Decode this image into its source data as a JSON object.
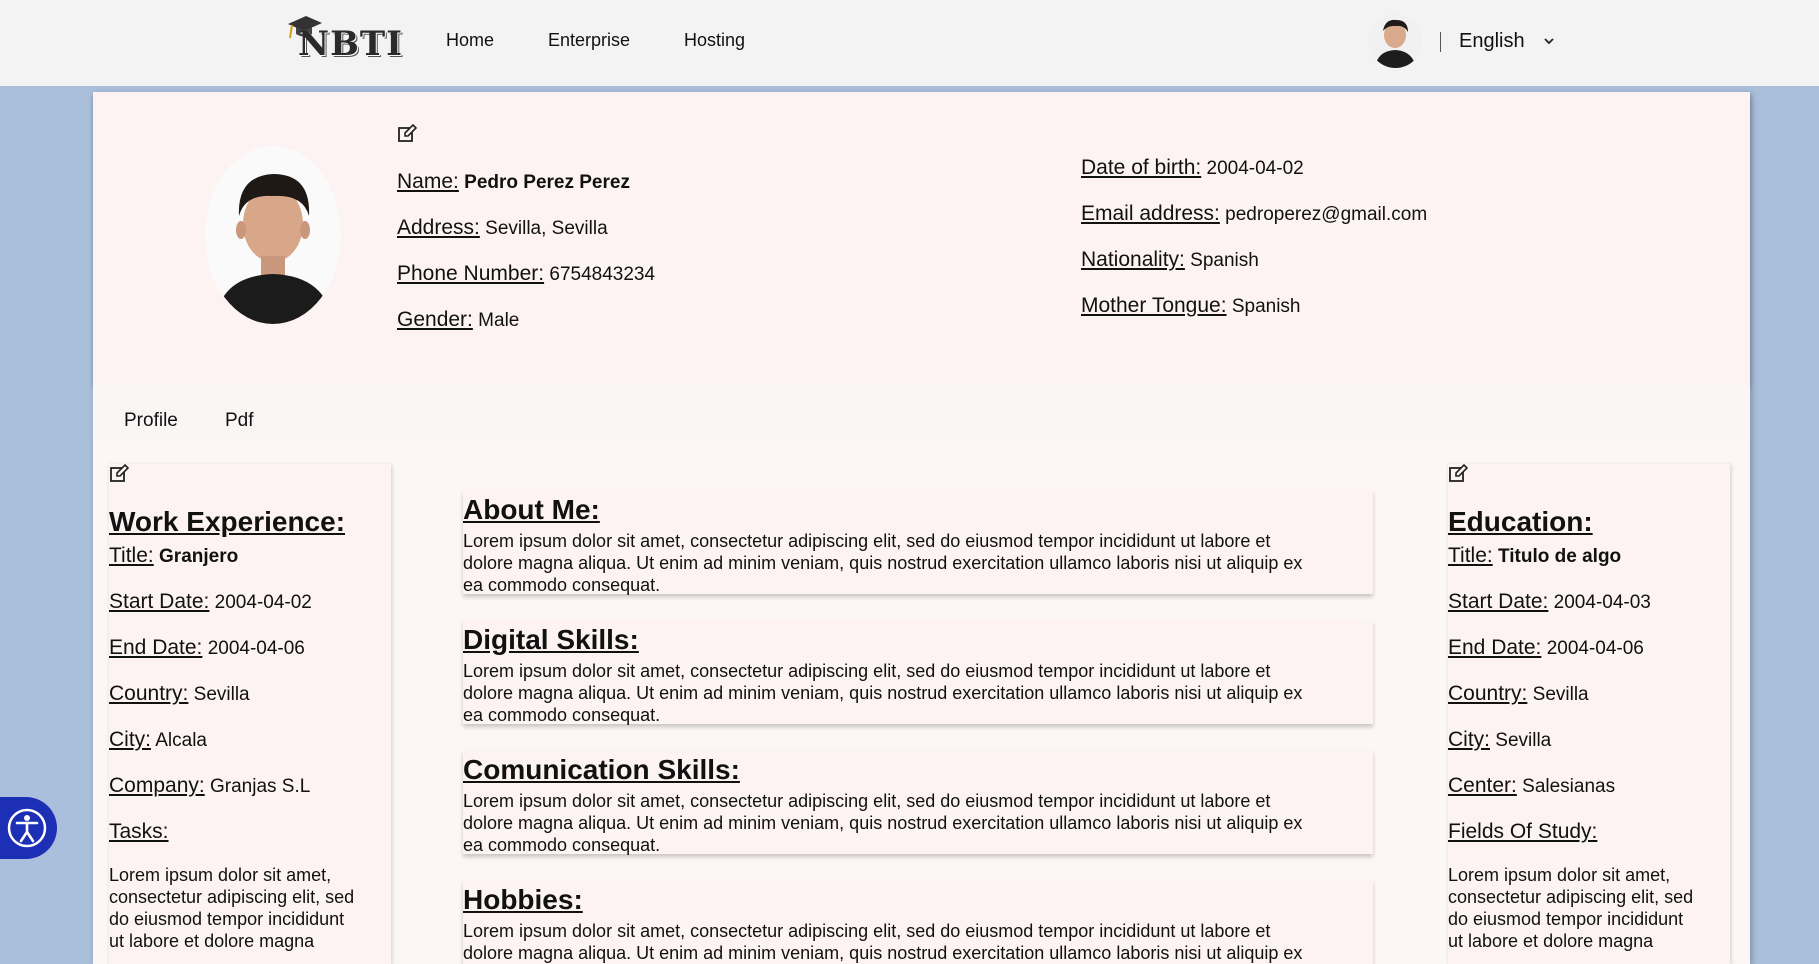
{
  "header": {
    "logo_text": "NBTI",
    "nav": [
      "Home",
      "Enterprise",
      "Hosting"
    ],
    "language": "English"
  },
  "profile": {
    "name_label": "Name:",
    "name": "Pedro Perez Perez",
    "address_label": "Address:",
    "address": "Sevilla, Sevilla",
    "phone_label": "Phone Number:",
    "phone": "6754843234",
    "gender_label": "Gender:",
    "gender": "Male",
    "dob_label": "Date of birth:",
    "dob": "2004-04-02",
    "email_label": "Email address:",
    "email": "pedroperez@gmail.com",
    "nationality_label": "Nationality:",
    "nationality": "Spanish",
    "mother_tongue_label": "Mother Tongue:",
    "mother_tongue": "Spanish"
  },
  "tabs": [
    "Profile",
    "Pdf"
  ],
  "work": {
    "heading": "Work Experience:",
    "title_label": "Title:",
    "title": "Granjero",
    "start_label": "Start Date:",
    "start": "2004-04-02",
    "end_label": "End Date:",
    "end": "2004-04-06",
    "country_label": "Country:",
    "country": "Sevilla",
    "city_label": "City:",
    "city": "Alcala",
    "company_label": "Company:",
    "company": "Granjas S.L",
    "tasks_label": "Tasks:",
    "tasks_l1": "Lorem ipsum dolor sit amet,",
    "tasks_l2": "consectetur adipiscing elit, sed",
    "tasks_l3": "do eiusmod tempor incididunt",
    "tasks_l4": "ut labore et dolore magna"
  },
  "education": {
    "heading": "Education:",
    "title_label": "Title:",
    "title": "Titulo de algo",
    "start_label": "Start Date:",
    "start": "2004-04-03",
    "end_label": "End Date:",
    "end": "2004-04-06",
    "country_label": "Country:",
    "country": "Sevilla",
    "city_label": "City:",
    "city": "Sevilla",
    "center_label": "Center:",
    "center": "Salesianas",
    "fields_label": "Fields Of Study:",
    "fields_l1": "Lorem ipsum dolor sit amet,",
    "fields_l2": "consectetur adipiscing elit, sed",
    "fields_l3": "do eiusmod tempor incididunt",
    "fields_l4": "ut labore et dolore magna"
  },
  "sections": [
    {
      "title": "About Me:",
      "l1": "Lorem ipsum dolor sit amet, consectetur adipiscing elit, sed do eiusmod tempor incididunt ut labore et",
      "l2": "dolore magna aliqua. Ut enim ad minim veniam, quis nostrud exercitation ullamco laboris nisi ut aliquip ex",
      "l3": "ea commodo consequat."
    },
    {
      "title": "Digital Skills:",
      "l1": "Lorem ipsum dolor sit amet, consectetur adipiscing elit, sed do eiusmod tempor incididunt ut labore et",
      "l2": "dolore magna aliqua. Ut enim ad minim veniam, quis nostrud exercitation ullamco laboris nisi ut aliquip ex",
      "l3": "ea commodo consequat."
    },
    {
      "title": "Comunication Skills:",
      "l1": "Lorem ipsum dolor sit amet, consectetur adipiscing elit, sed do eiusmod tempor incididunt ut labore et",
      "l2": "dolore magna aliqua. Ut enim ad minim veniam, quis nostrud exercitation ullamco laboris nisi ut aliquip ex",
      "l3": "ea commodo consequat."
    },
    {
      "title": "Hobbies:",
      "l1": "Lorem ipsum dolor sit amet, consectetur adipiscing elit, sed do eiusmod tempor incididunt ut labore et",
      "l2": "dolore magna aliqua. Ut enim ad minim veniam, quis nostrud exercitation ullamco laboris nisi ut aliquip ex",
      "l3": ""
    }
  ],
  "colors": {
    "page_bg": "#aabfdb",
    "card_bg": "#fdf6f6",
    "accessibility_bg": "#1c2fb5"
  },
  "icons": [
    "graduation-cap-icon",
    "chevron-down-icon",
    "edit-icon",
    "accessibility-icon"
  ]
}
